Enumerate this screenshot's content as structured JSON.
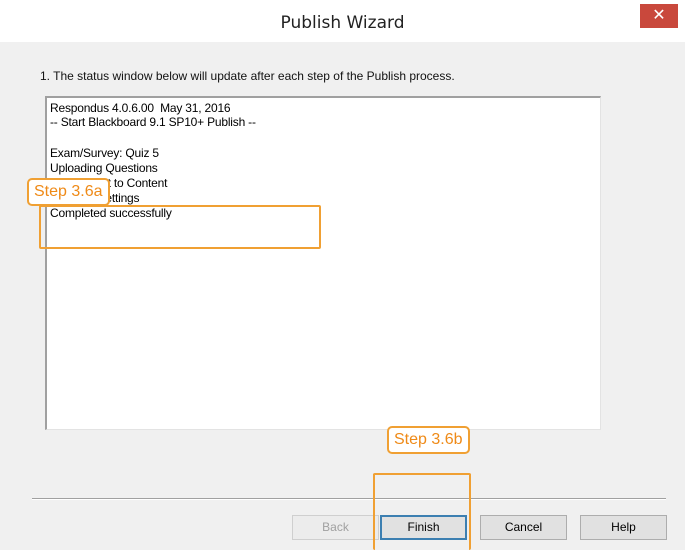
{
  "window": {
    "title": "Publish Wizard",
    "close_glyph": "✕"
  },
  "instruction": "1. The status window below will update after each step of the Publish process.",
  "status_lines": [
    "Respondus 4.0.6.00  May 31, 2016",
    "-- Start Blackboard 9.1 SP10+ Publish --",
    "",
    "Exam/Survey: Quiz 5",
    "Uploading Questions",
    "Linking Test to Content",
    "Applying Settings",
    "Completed successfully"
  ],
  "buttons": {
    "back": "Back",
    "finish": "Finish",
    "cancel": "Cancel",
    "help": "Help"
  },
  "annotations": {
    "step_a": "Step 3.6a",
    "step_b": "Step 3.6b",
    "accent_color": "#f0a033"
  },
  "colors": {
    "close_button": "#c9483c",
    "dialog_background": "#f0f0f0"
  },
  "icons": {
    "close": "close-icon"
  }
}
